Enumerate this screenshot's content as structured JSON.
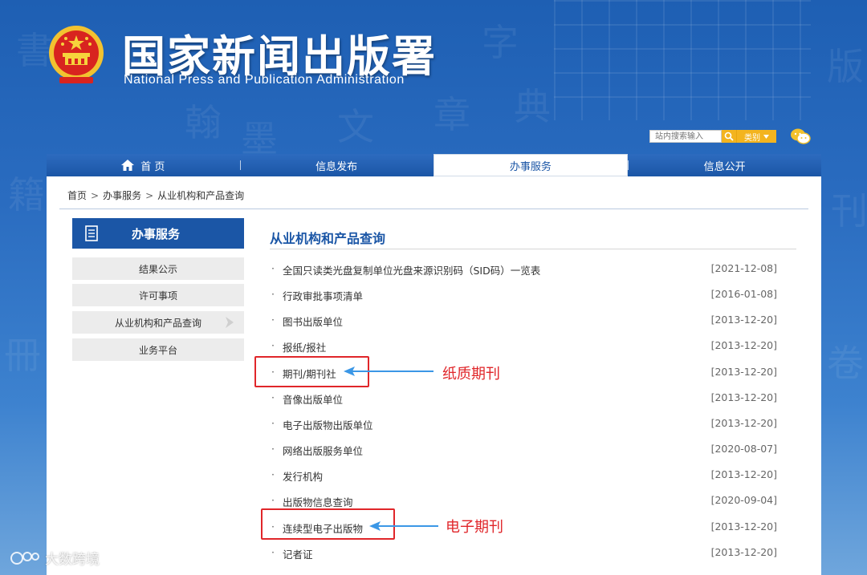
{
  "header": {
    "title": "国家新闻出版署",
    "subtitle": "National  Press and Publication Administration"
  },
  "search": {
    "placeholder": "站内搜索输入",
    "category_label": "类别"
  },
  "nav": {
    "items": [
      {
        "label": "首 页"
      },
      {
        "label": "信息发布"
      },
      {
        "label": "办事服务"
      },
      {
        "label": "信息公开"
      }
    ]
  },
  "breadcrumb": [
    "首页",
    "办事服务",
    "从业机构和产品查询"
  ],
  "breadcrumb_sep": ">",
  "sidebar": {
    "title": "办事服务",
    "items": [
      {
        "label": "结果公示"
      },
      {
        "label": "许可事项"
      },
      {
        "label": "从业机构和产品查询"
      },
      {
        "label": "业务平台"
      }
    ]
  },
  "content": {
    "title": "从业机构和产品查询",
    "bullet": "·",
    "items": [
      {
        "text": "全国只读类光盘复制单位光盘来源识别码（SID码）一览表",
        "date": "[2021-12-08]"
      },
      {
        "text": "行政审批事项清单",
        "date": "[2016-01-08]"
      },
      {
        "text": "图书出版单位",
        "date": "[2013-12-20]"
      },
      {
        "text": "报纸/报社",
        "date": "[2013-12-20]"
      },
      {
        "text": "期刊/期刊社",
        "date": "[2013-12-20]"
      },
      {
        "text": "音像出版单位",
        "date": "[2013-12-20]"
      },
      {
        "text": "电子出版物出版单位",
        "date": "[2013-12-20]"
      },
      {
        "text": "网络出版服务单位",
        "date": "[2020-08-07]"
      },
      {
        "text": "发行机构",
        "date": "[2013-12-20]"
      },
      {
        "text": "出版物信息查询",
        "date": "[2020-09-04]"
      },
      {
        "text": "连续型电子出版物",
        "date": "[2013-12-20]"
      },
      {
        "text": "记者证",
        "date": "[2013-12-20]"
      }
    ]
  },
  "annotations": [
    {
      "label": "纸质期刊"
    },
    {
      "label": "电子期刊"
    }
  ],
  "watermark": "大数跨境",
  "colors": {
    "brand_blue": "#1b56a6",
    "annotation_red": "#e0262a",
    "search_yellow": "#f3b41f"
  }
}
